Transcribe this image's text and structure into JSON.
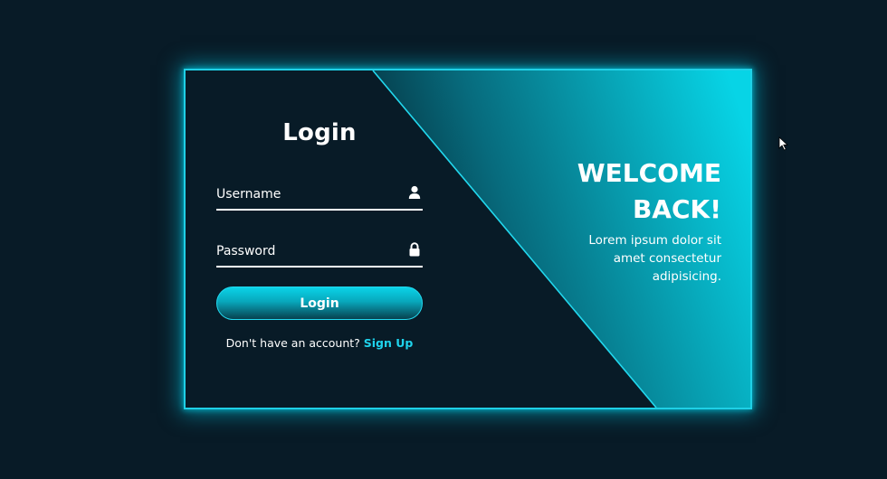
{
  "login": {
    "title": "Login",
    "username_placeholder": "Username",
    "password_placeholder": "Password",
    "username_icon": "user-icon",
    "password_icon": "lock-icon",
    "button_label": "Login",
    "signup_prompt": "Don't have an account?",
    "signup_link": "Sign Up"
  },
  "info": {
    "title_line1": "WELCOME",
    "title_line2": "BACK!",
    "body_line1": "Lorem ipsum dolor sit",
    "body_line2": "amet consectetur",
    "body_line3": "adipisicing."
  },
  "colors": {
    "background": "#081b27",
    "accent": "#1fd0e6",
    "link": "#1fd3ec"
  }
}
